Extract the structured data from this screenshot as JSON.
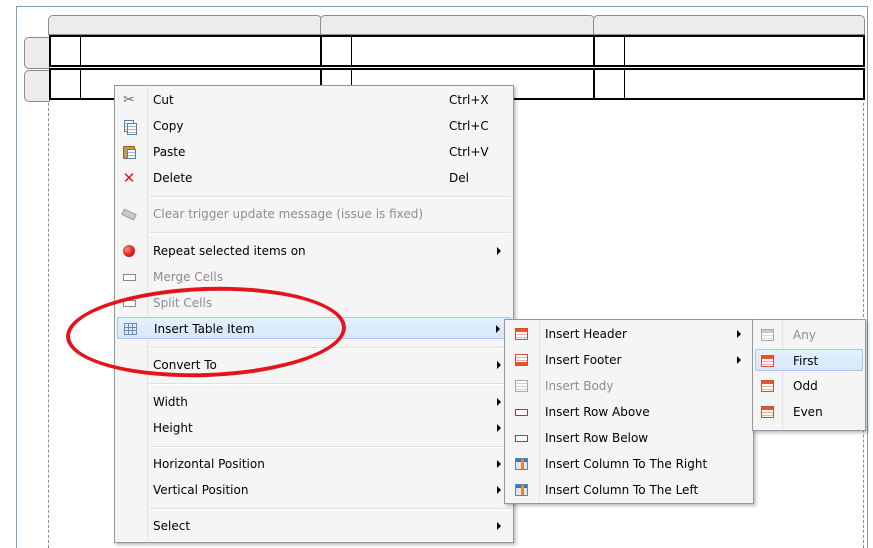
{
  "colors": {
    "menu_bg": "#f5f5f5",
    "highlight": "#d6e8fa",
    "annotation": "#e5141b",
    "disabled_text": "#8d8d8d"
  },
  "context_menu": {
    "items": [
      {
        "label": "Cut",
        "shortcut": "Ctrl+X",
        "icon": "scissors-icon",
        "enabled": true
      },
      {
        "label": "Copy",
        "shortcut": "Ctrl+C",
        "icon": "copy-icon",
        "enabled": true
      },
      {
        "label": "Paste",
        "shortcut": "Ctrl+V",
        "icon": "paste-icon",
        "enabled": true
      },
      {
        "label": "Delete",
        "shortcut": "Del",
        "icon": "delete-icon",
        "enabled": true
      },
      {
        "label": "Clear trigger update message (issue is fixed)",
        "icon": "eraser-icon",
        "enabled": false
      },
      {
        "label": "Repeat selected items on",
        "icon": "red-dot-icon",
        "submenu": true,
        "enabled": true
      },
      {
        "label": "Merge Cells",
        "icon": "merge-cells-icon",
        "enabled": false
      },
      {
        "label": "Split Cells",
        "icon": "split-cells-icon",
        "enabled": false
      },
      {
        "label": "Insert Table Item",
        "icon": "table-icon",
        "submenu": true,
        "highlighted": true,
        "enabled": true
      },
      {
        "label": "Convert To",
        "submenu": true,
        "enabled": true
      },
      {
        "label": "Width",
        "submenu": true,
        "enabled": true
      },
      {
        "label": "Height",
        "submenu": true,
        "enabled": true
      },
      {
        "label": "Horizontal Position",
        "submenu": true,
        "enabled": true
      },
      {
        "label": "Vertical Position",
        "submenu": true,
        "enabled": true
      },
      {
        "label": "Select",
        "submenu": true,
        "enabled": true
      }
    ]
  },
  "insert_table_item_menu": {
    "items": [
      {
        "label": "Insert Header",
        "icon": "header-table-icon",
        "submenu": true,
        "enabled": true
      },
      {
        "label": "Insert Footer",
        "icon": "footer-table-icon",
        "submenu": true,
        "enabled": true
      },
      {
        "label": "Insert Body",
        "icon": "body-table-icon",
        "enabled": false
      },
      {
        "label": "Insert Row Above",
        "icon": "row-above-icon",
        "enabled": true
      },
      {
        "label": "Insert Row Below",
        "icon": "row-below-icon",
        "enabled": true
      },
      {
        "label": "Insert Column To The Right",
        "icon": "column-right-icon",
        "enabled": true
      },
      {
        "label": "Insert Column To The Left",
        "icon": "column-left-icon",
        "enabled": true
      }
    ]
  },
  "insert_header_menu": {
    "items": [
      {
        "label": "Any",
        "icon": "any-header-icon",
        "enabled": false
      },
      {
        "label": "First",
        "icon": "first-header-icon",
        "highlighted": true,
        "enabled": true
      },
      {
        "label": "Odd",
        "icon": "odd-header-icon",
        "enabled": true
      },
      {
        "label": "Even",
        "icon": "even-header-icon",
        "enabled": true
      }
    ]
  }
}
